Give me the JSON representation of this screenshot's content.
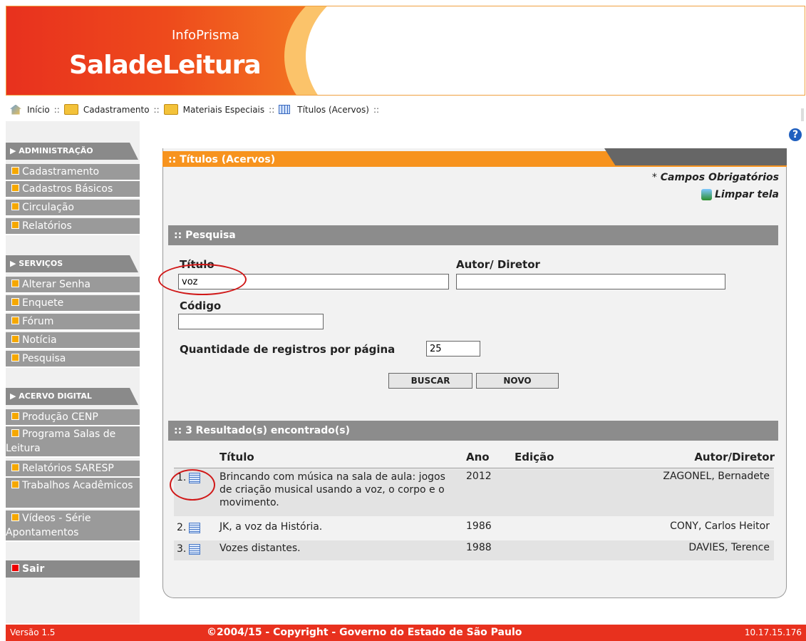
{
  "header": {
    "brand_small": "InfoPrisma",
    "brand_big": "SaladeLeitura"
  },
  "breadcrumb": [
    "Início",
    "Cadastramento",
    "Materiais Especiais",
    "Títulos (Acervos)"
  ],
  "breadcrumb_sep": "::",
  "sidebar": {
    "admin": {
      "title": "ADMINISTRAÇÃO",
      "items": [
        "Cadastramento",
        "Cadastros Básicos",
        "Circulação",
        "Relatórios"
      ]
    },
    "servicos": {
      "title": "SERVIÇOS",
      "items": [
        "Alterar Senha",
        "Enquete",
        "Fórum",
        "Notícia",
        "Pesquisa"
      ]
    },
    "acervo": {
      "title": "ACERVO DIGITAL",
      "items": [
        "Produção CENP",
        "Programa Salas de Leitura",
        "Relatórios SARESP",
        "Trabalhos Acadêmicos",
        "Vídeos - Série Apontamentos"
      ]
    },
    "sair": "Sair"
  },
  "panel": {
    "title": ":: Títulos (Acervos)",
    "required_prefix": "*",
    "required": "Campos Obrigatórios",
    "clear": "Limpar tela"
  },
  "search": {
    "section": ":: Pesquisa",
    "titulo_label": "Título",
    "titulo_value": "voz",
    "autor_label": "Autor/ Diretor",
    "autor_value": "",
    "codigo_label": "Código",
    "codigo_value": "",
    "qty_label": "Quantidade de registros por página",
    "qty_value": "25",
    "buscar": "BUSCAR",
    "novo": "NOVO"
  },
  "results": {
    "section": ":: 3 Resultado(s) encontrado(s)",
    "headers": {
      "titulo": "Título",
      "ano": "Ano",
      "edicao": "Edição",
      "autor": "Autor/Diretor"
    },
    "rows": [
      {
        "num": "1.",
        "titulo": "Brincando com música na sala de aula: jogos de criação musical usando a voz, o corpo e o movimento.",
        "ano": "2012",
        "edicao": "",
        "autor": "ZAGONEL, Bernadete"
      },
      {
        "num": "2.",
        "titulo": "JK, a voz da História.",
        "ano": "1986",
        "edicao": "",
        "autor": "CONY, Carlos Heitor"
      },
      {
        "num": "3.",
        "titulo": "Vozes distantes.",
        "ano": "1988",
        "edicao": "",
        "autor": "DAVIES, Terence"
      }
    ]
  },
  "footer": {
    "version": "Versão 1.5",
    "copyright": "©2004/15 - Copyright - Governo do Estado de São Paulo",
    "ip": "10.17.15.176"
  }
}
